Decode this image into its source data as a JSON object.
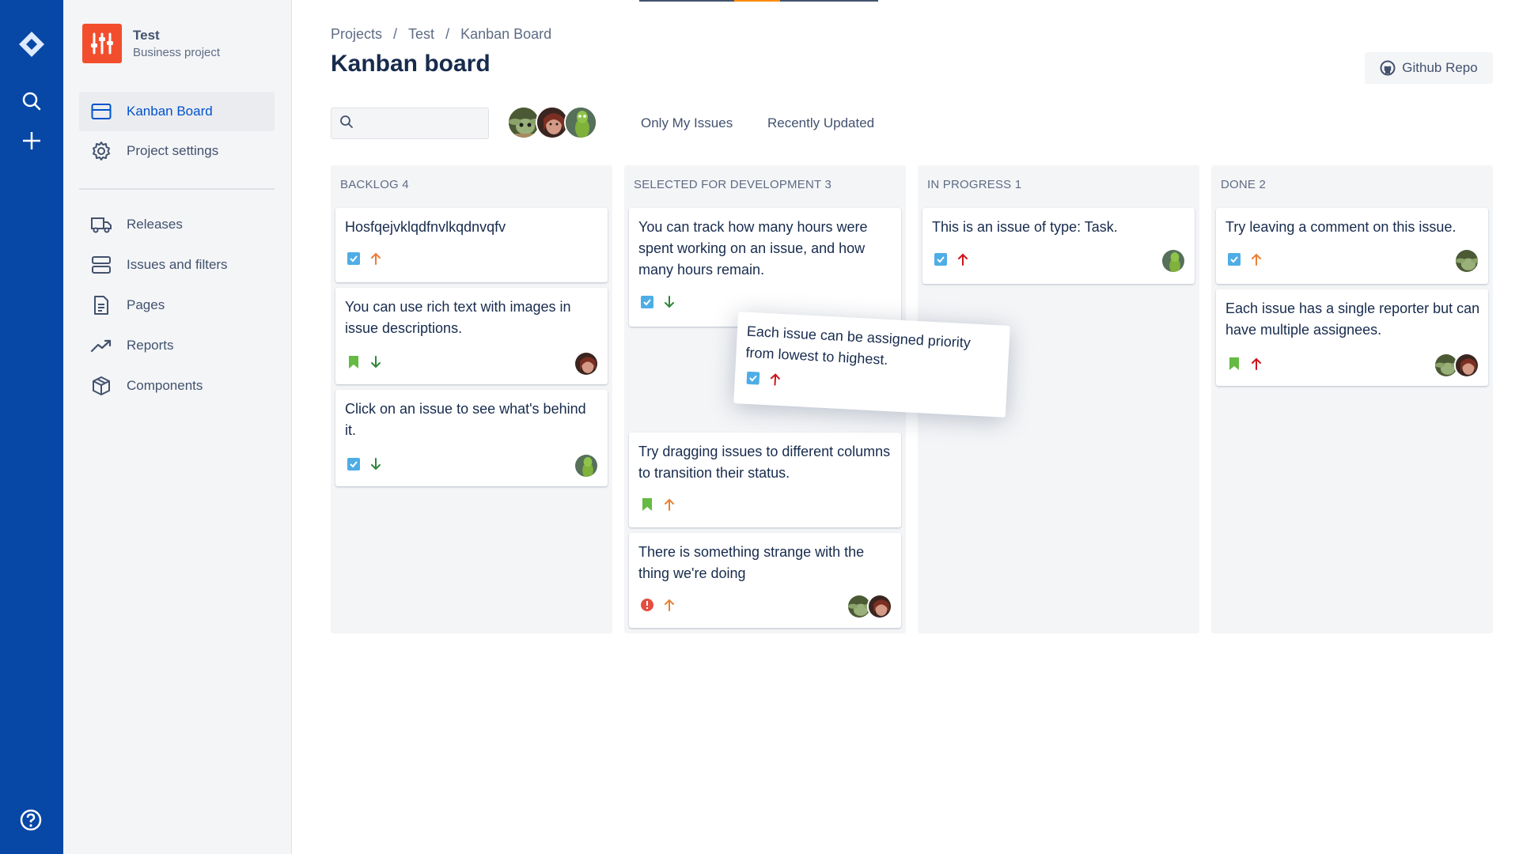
{
  "project": {
    "name": "Test",
    "type": "Business project"
  },
  "sidebar": {
    "items": [
      {
        "label": "Kanban Board"
      },
      {
        "label": "Project settings"
      },
      {
        "label": "Releases"
      },
      {
        "label": "Issues and filters"
      },
      {
        "label": "Pages"
      },
      {
        "label": "Reports"
      },
      {
        "label": "Components"
      }
    ]
  },
  "breadcrumb": [
    "Projects",
    "Test",
    "Kanban Board"
  ],
  "page_title": "Kanban board",
  "github_button": "Github Repo",
  "filters": {
    "search_placeholder": "",
    "only_my": "Only My Issues",
    "recent": "Recently Updated"
  },
  "colors": {
    "nav": "#0747a6",
    "accent": "#0052cc",
    "task": "#4fade6",
    "story": "#65ba43",
    "bug": "#e44d42",
    "priority_high": "#e97f33",
    "priority_highest": "#cd1317",
    "priority_low": "#2d8738"
  },
  "columns": [
    {
      "title": "Backlog 4",
      "cards": [
        {
          "title": "Hosfqejvklqdfnvlkqdnvqfv",
          "type": "task-icon",
          "priority": "arrow-up-icon",
          "avatars": []
        },
        {
          "title": "You can use rich text with images in issue descriptions.",
          "type": "story-icon",
          "priority": "arrow-down-icon",
          "avatars": [
            "avatar-2"
          ]
        },
        {
          "title": "Click on an issue to see what's behind it.",
          "type": "task-icon",
          "priority": "arrow-down-icon",
          "avatars": [
            "avatar-3"
          ]
        }
      ]
    },
    {
      "title": "Selected for development 3",
      "cards": [
        {
          "title": "You can track how many hours were spent working on an issue, and how many hours remain.",
          "type": "task-icon",
          "priority": "arrow-down-icon",
          "avatars": []
        },
        {
          "title": "Try dragging issues to different columns to transition their status.",
          "type": "story-icon",
          "priority": "arrow-up-icon",
          "avatars": []
        },
        {
          "title": "There is something strange with the thing we're doing",
          "type": "bug-icon",
          "priority": "arrow-up-icon",
          "avatars": [
            "avatar-1",
            "avatar-2"
          ]
        }
      ]
    },
    {
      "title": "In progress 1",
      "cards": [
        {
          "title": "This is an issue of type: Task.",
          "type": "task-icon",
          "priority": "arrow-up-icon",
          "avatars": [
            "avatar-3"
          ]
        }
      ]
    },
    {
      "title": "Done 2",
      "cards": [
        {
          "title": "Try leaving a comment on this issue.",
          "type": "task-icon",
          "priority": "arrow-up-icon",
          "avatars": [
            "avatar-1"
          ]
        },
        {
          "title": "Each issue has a single reporter but can have multiple assignees.",
          "type": "story-icon",
          "priority": "arrow-up-icon",
          "avatars": [
            "avatar-1",
            "avatar-2"
          ]
        }
      ]
    }
  ],
  "dragging_card": {
    "title": "Each issue can be assigned priority from lowest to highest.",
    "type": "task-icon",
    "priority": "arrow-up-icon"
  }
}
